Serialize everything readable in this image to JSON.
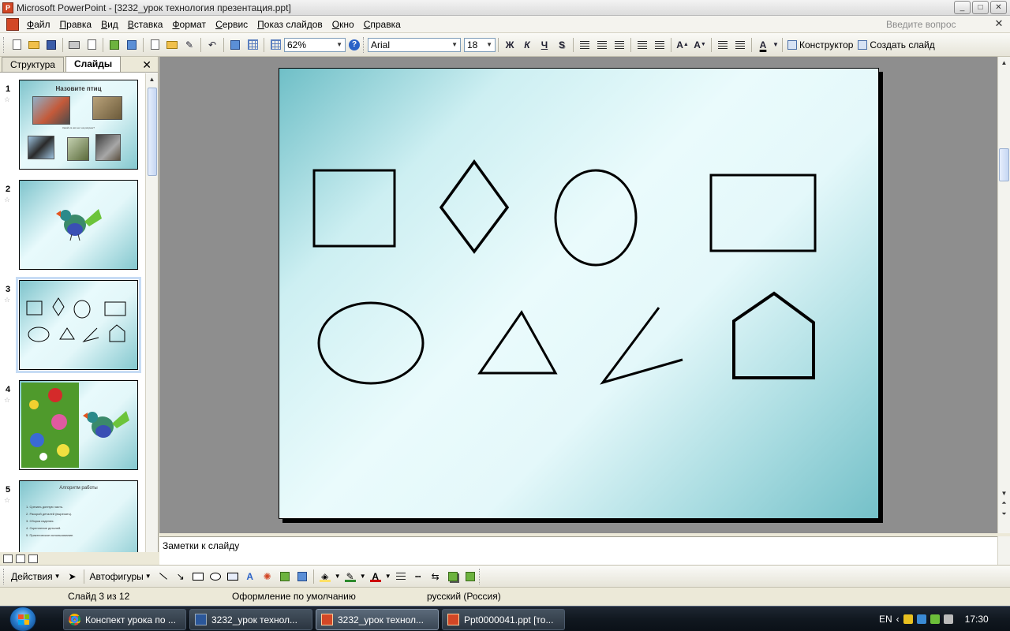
{
  "window": {
    "title": "Microsoft PowerPoint - [3232_урок технология презентация.ppt]",
    "app_icon": "P",
    "buttons": [
      "_",
      "□",
      "✕"
    ]
  },
  "menu": {
    "items": [
      "Файл",
      "Правка",
      "Вид",
      "Вставка",
      "Формат",
      "Сервис",
      "Показ слайдов",
      "Окно",
      "Справка"
    ],
    "ask_placeholder": "Введите вопрос",
    "close": "✕"
  },
  "toolbar": {
    "zoom": "62%",
    "font": "Arial",
    "font_size": "18",
    "bold": "Ж",
    "italic": "К",
    "underline": "Ч",
    "shadow": "S",
    "designer": "Конструктор",
    "new_slide": "Создать слайд"
  },
  "left_pane": {
    "tabs": [
      "Структура",
      "Слайды"
    ],
    "close": "✕",
    "slides": [
      {
        "num": "1",
        "title": "Назовите птиц",
        "subtitle": "Какой из них нет на рисунке?"
      },
      {
        "num": "2"
      },
      {
        "num": "3"
      },
      {
        "num": "4"
      },
      {
        "num": "5",
        "title": "Алгоритм работы",
        "list": [
          "1.   Срезать донную часть.",
          "2.   Раскрой деталей (вырезать).",
          "3.   Сборка изделия.",
          "4.   Скрепление деталей.",
          "5.   Практическое использование."
        ]
      }
    ],
    "selected_slide": "3"
  },
  "slide": {
    "shapes": [
      "square",
      "diamond",
      "circle",
      "rectangle",
      "ellipse",
      "triangle",
      "angle",
      "pentagon"
    ]
  },
  "notes": {
    "placeholder": "Заметки к слайду"
  },
  "draw_toolbar": {
    "actions": "Действия",
    "autoshapes": "Автофигуры",
    "colors": {
      "fill": "#ffe066",
      "line": "#2d8a2d",
      "font": "#cc0000"
    }
  },
  "status": {
    "slide": "Слайд 3 из 12",
    "design": "Оформление по умолчанию",
    "language": "русский (Россия)"
  },
  "taskbar": {
    "buttons": [
      {
        "label": "Конспект урока по ...",
        "icon": "chrome-icon"
      },
      {
        "label": "3232_урок технол...",
        "icon": "word-icon"
      },
      {
        "label": "3232_урок технол...",
        "icon": "powerpoint-icon"
      },
      {
        "label": "Ppt0000041.ppt [то...",
        "icon": "powerpoint-icon"
      }
    ],
    "lang": "EN",
    "time": "17:30"
  }
}
